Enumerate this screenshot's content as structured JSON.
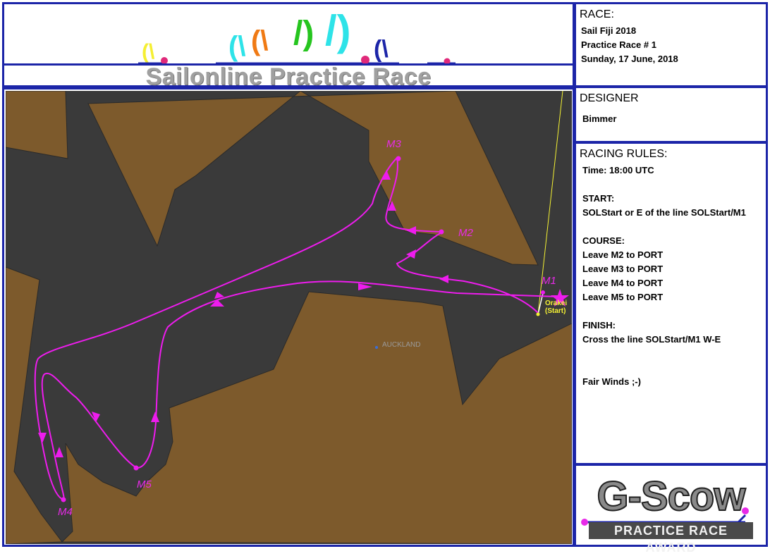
{
  "header": {
    "title": "Sailonline Practice Race",
    "sail_colors": [
      "#f5ef33",
      "#2ee3e8",
      "#f07a14",
      "#26c51f",
      "#2ee3e8",
      "#1c25a8"
    ],
    "accent_dot_color": "#e0297a"
  },
  "race": {
    "heading": "RACE:",
    "event": "Sail Fiji 2018",
    "name": "Practice Race # 1",
    "date": "Sunday, 17 June, 2018"
  },
  "designer": {
    "heading": "DESIGNER",
    "name": "Bimmer"
  },
  "rules": {
    "heading": "RACING RULES:",
    "time": "Time: 18:00 UTC",
    "start_heading": "START:",
    "start_text": "SOLStart or E of the line SOLStart/M1",
    "course_heading": "COURSE:",
    "course_items": [
      "Leave M2 to PORT",
      "Leave M3 to PORT",
      "Leave M4 to PORT",
      "Leave M5 to PORT"
    ],
    "finish_heading": "FINISH:",
    "finish_text": "Cross the line SOLStart/M1 W-E",
    "closing": "Fair Winds ;-)"
  },
  "map": {
    "city_label": "AUCKLAND",
    "start_label_line1": "Orakei",
    "start_label_line2": "(Start)",
    "marks": [
      "M1",
      "M2",
      "M3",
      "M4",
      "M5"
    ],
    "land_color": "#7d5a2c",
    "water_color": "#3a3a3a",
    "route_color": "#ee1cee",
    "start_color": "#f5f233"
  },
  "logo": {
    "main_text": "G-Scow",
    "sub_text": "PRACTICE RACE AWARD"
  }
}
